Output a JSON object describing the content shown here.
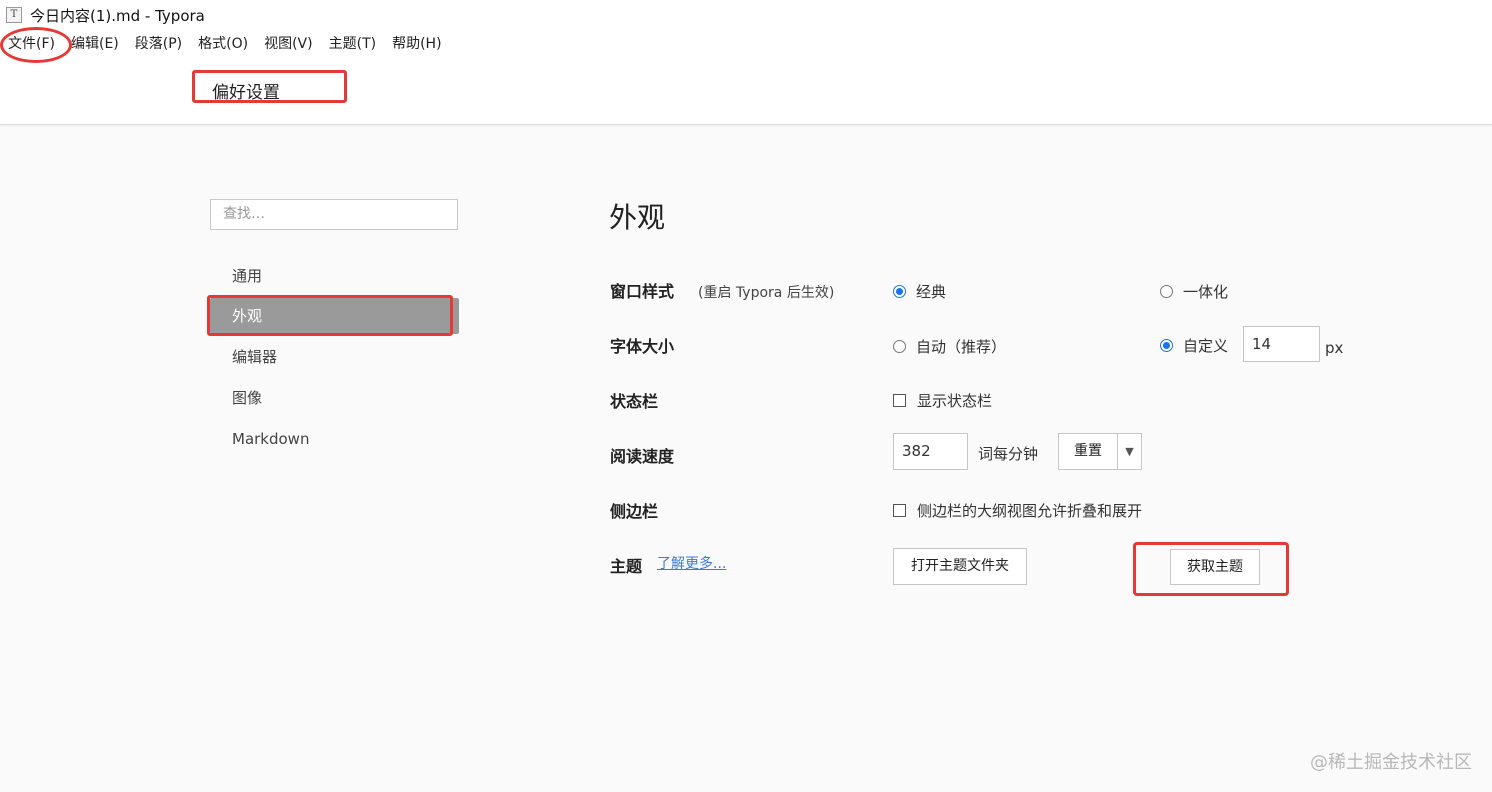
{
  "window": {
    "title": "今日内容(1).md - Typora",
    "icon_letter": "T"
  },
  "menu": [
    "文件(F)",
    "编辑(E)",
    "段落(P)",
    "格式(O)",
    "视图(V)",
    "主题(T)",
    "帮助(H)"
  ],
  "preferences_title": "偏好设置",
  "sidebar": {
    "search_placeholder": "查找…",
    "items": [
      "通用",
      "外观",
      "编辑器",
      "图像",
      "Markdown"
    ],
    "active_item": "外观"
  },
  "section_title": "外观",
  "settings": {
    "window_style": {
      "label": "窗口样式",
      "hint": "(重启 Typora 后生效)",
      "options": [
        "经典",
        "一体化"
      ],
      "selected": "经典"
    },
    "font_size": {
      "label": "字体大小",
      "options": [
        "自动（推荐）",
        "自定义"
      ],
      "selected": "自定义",
      "value": "14",
      "unit": "px"
    },
    "status_bar": {
      "label": "状态栏",
      "checkbox_label": "显示状态栏",
      "checked": false
    },
    "reading_speed": {
      "label": "阅读速度",
      "value": "382",
      "unit": "词每分钟",
      "reset_button": "重置"
    },
    "sidebar": {
      "label": "侧边栏",
      "checkbox_label": "侧边栏的大纲视图允许折叠和展开",
      "checked": false
    },
    "theme": {
      "label": "主题",
      "learn_more": "了解更多...",
      "open_folder_button": "打开主题文件夹",
      "get_themes_button": "获取主题"
    }
  },
  "watermark": "@稀土掘金技术社区",
  "colors": {
    "annotation": "#e53935",
    "accent": "#1a73e8",
    "active_nav": "#9a9a9a"
  }
}
